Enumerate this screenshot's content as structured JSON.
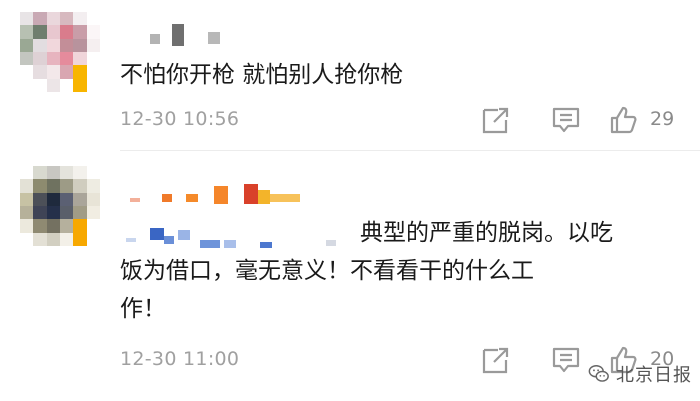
{
  "comments": [
    {
      "text": "不怕你开枪 就怕别人抢你枪",
      "time": "12-30 10:56",
      "like_count": "29",
      "icons": [
        "share-icon",
        "comment-icon",
        "like-icon"
      ]
    },
    {
      "text_line1": "典型的严重的脱岗。以吃",
      "text_line2": "饭为借口，毫无意义！不看看干的什么工",
      "text_line3": "作！",
      "time": "12-30 11:00",
      "like_count": "20",
      "icons": [
        "share-icon",
        "comment-icon",
        "like-icon"
      ]
    }
  ],
  "watermark": {
    "text": "北京日报",
    "icon": "wechat-icon"
  },
  "colors": {
    "text": "#1a1a1a",
    "meta": "#a0a0a0",
    "icon": "#9a9a9a"
  }
}
